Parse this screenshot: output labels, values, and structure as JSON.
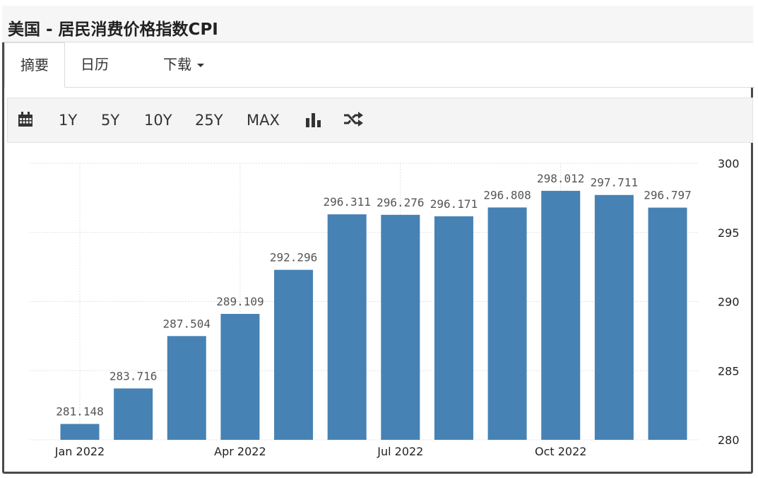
{
  "header": {
    "title": "美国 - 居民消费价格指数CPI"
  },
  "tabs": [
    {
      "label": "摘要",
      "active": true
    },
    {
      "label": "日历",
      "active": false
    },
    {
      "label": "下载",
      "active": false,
      "dropdown": true
    }
  ],
  "toolbar": {
    "calendar_icon": "calendar-icon",
    "ranges": [
      "1Y",
      "5Y",
      "10Y",
      "25Y",
      "MAX"
    ],
    "bar_chart_icon": "bar-chart-icon",
    "shuffle_icon": "shuffle-icon"
  },
  "colors": {
    "bar": "#4682b4",
    "grid": "#e0e0e0",
    "frame": "#4a4a4a"
  },
  "chart_data": {
    "type": "bar",
    "categories": [
      "Jan 2022",
      "Feb 2022",
      "Mar 2022",
      "Apr 2022",
      "May 2022",
      "Jun 2022",
      "Jul 2022",
      "Aug 2022",
      "Sep 2022",
      "Oct 2022",
      "Nov 2022",
      "Dec 2022"
    ],
    "values": [
      281.148,
      283.716,
      287.504,
      289.109,
      292.296,
      296.311,
      296.276,
      296.171,
      296.808,
      298.012,
      297.711,
      296.797
    ],
    "value_labels": [
      "281.148",
      "283.716",
      "287.504",
      "289.109",
      "292.296",
      "296.311",
      "296.276",
      "296.171",
      "296.808",
      "298.012",
      "297.711",
      "296.797"
    ],
    "x_tick_labels": [
      "Jan 2022",
      "Apr 2022",
      "Jul 2022",
      "Oct 2022"
    ],
    "y_ticks": [
      "280",
      "285",
      "290",
      "295",
      "300"
    ],
    "ylim": [
      280,
      300
    ],
    "y_axis_side": "right",
    "grid": true,
    "title": "",
    "xlabel": "",
    "ylabel": ""
  }
}
